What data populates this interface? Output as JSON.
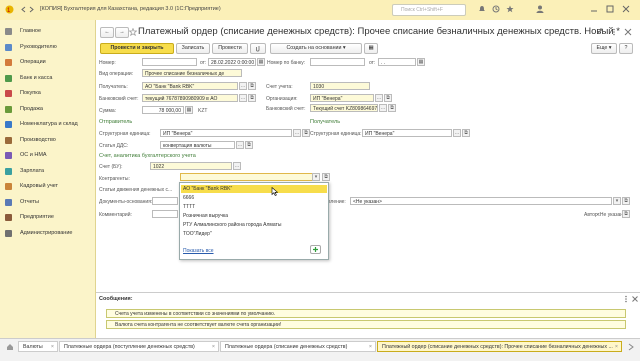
{
  "window": {
    "title": "[КОПИЯ] Бухгалтерия для Казахстана, редакция 3.0  (1С:Предприятие)",
    "search_placeholder": "Поиск Ctrl+Shift+F"
  },
  "sidebar": {
    "items": [
      {
        "label": "Главное",
        "icon": "menu-icon",
        "color": "#8a8a8a"
      },
      {
        "label": "Руководителю",
        "icon": "chart-icon",
        "color": "#5b8ac9"
      },
      {
        "label": "Операции",
        "icon": "operations-icon",
        "color": "#d37b3b"
      },
      {
        "label": "Банк и касса",
        "icon": "bank-icon",
        "color": "#4f9a4b"
      },
      {
        "label": "Покупка",
        "icon": "cart-icon",
        "color": "#c94a4a"
      },
      {
        "label": "Продажа",
        "icon": "sale-icon",
        "color": "#6a9a3a"
      },
      {
        "label": "Номенклатура и склад",
        "icon": "warehouse-icon",
        "color": "#3a7ac9"
      },
      {
        "label": "Производство",
        "icon": "factory-icon",
        "color": "#9a6a3a"
      },
      {
        "label": "ОС и НМА",
        "icon": "assets-icon",
        "color": "#7a5ab5"
      },
      {
        "label": "Зарплата",
        "icon": "salary-icon",
        "color": "#3aa0a0"
      },
      {
        "label": "Кадровый учет",
        "icon": "staff-icon",
        "color": "#c9843a"
      },
      {
        "label": "Отчеты",
        "icon": "report-icon",
        "color": "#5a7ab5"
      },
      {
        "label": "Предприятие",
        "icon": "company-icon",
        "color": "#8a5a3a"
      },
      {
        "label": "Администрирование",
        "icon": "gear-icon",
        "color": "#707070"
      }
    ]
  },
  "form": {
    "title": "Платежный ордер (списание денежных средств): Прочее списание безналичных денежных средств. Новый *",
    "toolbar": {
      "post_close": "Провести и закрыть",
      "save": "Записать",
      "post": "Провести",
      "create_based": "Создать на основании",
      "more": "Еще",
      "help": "?"
    },
    "number_label": "Номер:",
    "number_value": "",
    "date_from_label": "от:",
    "date_value": "28.02.2022  0:00:00",
    "bank_number_label": "Номер по банку:",
    "bank_number_value": "",
    "bank_date_label": "от:",
    "bank_date_value": " .  .",
    "operation_label": "Вид операции:",
    "operation_value": "Прочее списание безналичных де",
    "payer_label": "Получатель:",
    "payer_value": "АО \"Банк \"Bank RBK\"",
    "bank_account_label": "Банковский счет:",
    "bank_account_value": "текущий 76787890980909 в АО",
    "sum_label": "Сумма:",
    "sum_value": "78 000,00",
    "currency": "KZT",
    "account_label": "Счет учета:",
    "account_value": "1030",
    "org_label": "Организация:",
    "org_value": "ИП \"Венера\"",
    "bank_acc_org_label": "Банковский счет:",
    "bank_acc_org_value": "Текущий счет KZ809864697769799",
    "sender_group": "Отправитель",
    "receiver_group": "Получатель",
    "struct_unit_label": "Структурная единица:",
    "struct_unit_value": "ИП \"Венера\"",
    "struct_unit2_label": "Структурная единица:",
    "struct_unit2_value": "ИП \"Венера\"",
    "dds_label": "Статья ДДС:",
    "dds_value": "конвертация валюты",
    "analytics_group": "Счет, аналитика бухгалтерского учета",
    "bu_account_label": "Счет (БУ):",
    "bu_account_value": "1022",
    "counterparty_label": "Контрагенты:",
    "counterparty_value": "",
    "cash_flow_label": "Статьи движения денежных с...",
    "document_label": "Документы-основания:",
    "comment_label": "Комментарий:",
    "subdivision_label": "Подразделение:",
    "subdivision_value": "<Не указан>",
    "author_label": "Автор:",
    "author_value": "<Не указан>",
    "dropdown": {
      "items": [
        "АО \"Банк \"Bank RBK\"",
        "6666",
        "ТТТТ",
        "Розничная выручка",
        "РТУ Алмалинского района города Алматы",
        "ТОО\"Лидер\""
      ],
      "show_all": "Показать все"
    }
  },
  "messages": {
    "title": "Сообщения:",
    "items": [
      "Счета учета изменены в соответствии со значениями по умолчанию.",
      "Валюта счета контрагента не соответствует валюте счета организации!"
    ]
  },
  "tabs": [
    {
      "label": "Валюты"
    },
    {
      "label": "Платежные ордера (поступление денежных средств)"
    },
    {
      "label": "Платежные ордера (списание денежных средств)"
    },
    {
      "label": "Платежный ордер (списание денежных средств): Прочее списание безналичных денежных ..."
    }
  ]
}
